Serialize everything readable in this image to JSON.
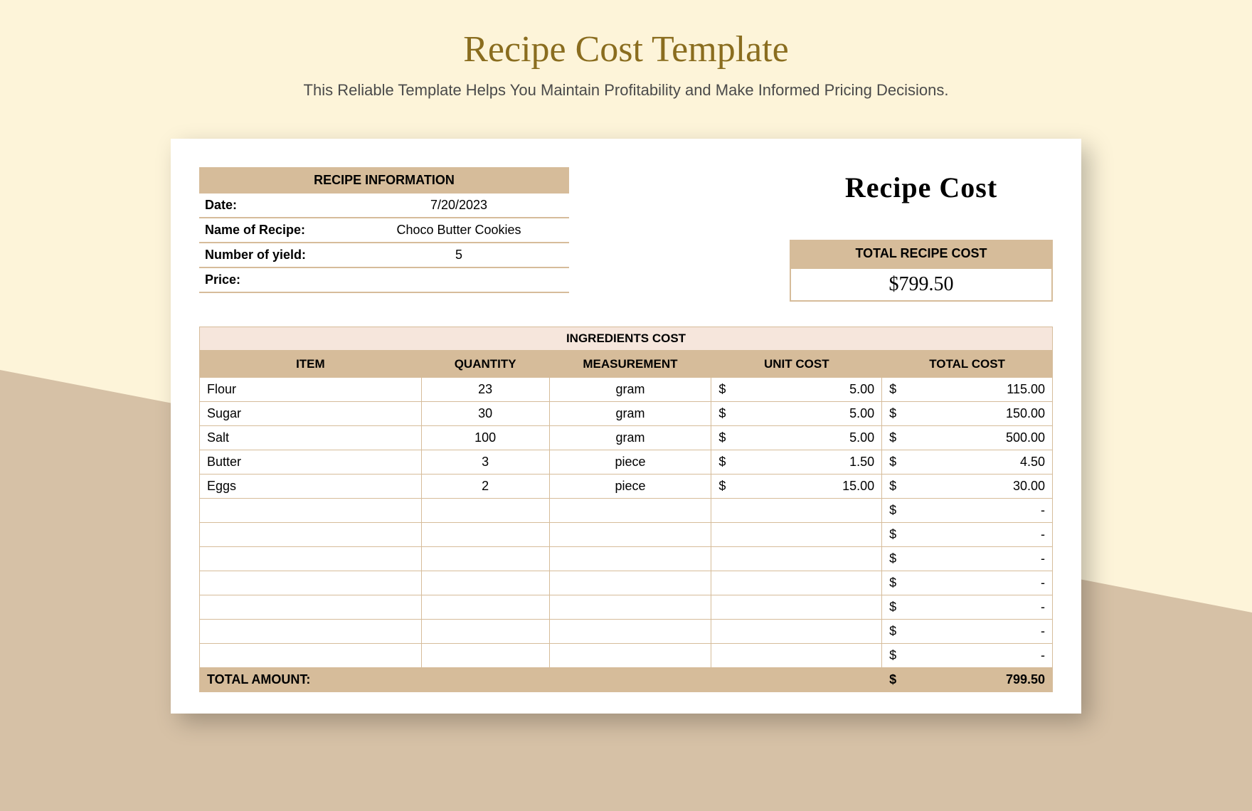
{
  "page": {
    "title": "Recipe Cost Template",
    "subtitle": "This Reliable Template Helps You Maintain Profitability and Make Informed Pricing Decisions."
  },
  "info": {
    "header": "RECIPE INFORMATION",
    "date_label": "Date:",
    "date_value": "7/20/2023",
    "name_label": "Name of Recipe:",
    "name_value": "Choco Butter Cookies",
    "yield_label": "Number of yield:",
    "yield_value": "5",
    "price_label": "Price:",
    "price_value": ""
  },
  "right": {
    "title": "Recipe Cost",
    "total_label": "TOTAL RECIPE COST",
    "total_value": "$799.50"
  },
  "ingredients": {
    "title": "INGREDIENTS COST",
    "headers": {
      "item": "ITEM",
      "qty": "QUANTITY",
      "meas": "MEASUREMENT",
      "unit": "UNIT COST",
      "total": "TOTAL COST"
    },
    "rows": [
      {
        "item": "Flour",
        "qty": "23",
        "meas": "gram",
        "unit": "5.00",
        "total": "115.00"
      },
      {
        "item": "Sugar",
        "qty": "30",
        "meas": "gram",
        "unit": "5.00",
        "total": "150.00"
      },
      {
        "item": "Salt",
        "qty": "100",
        "meas": "gram",
        "unit": "5.00",
        "total": "500.00"
      },
      {
        "item": "Butter",
        "qty": "3",
        "meas": "piece",
        "unit": "1.50",
        "total": "4.50"
      },
      {
        "item": "Eggs",
        "qty": "2",
        "meas": "piece",
        "unit": "15.00",
        "total": "30.00"
      },
      {
        "item": "",
        "qty": "",
        "meas": "",
        "unit": "",
        "total": "-"
      },
      {
        "item": "",
        "qty": "",
        "meas": "",
        "unit": "",
        "total": "-"
      },
      {
        "item": "",
        "qty": "",
        "meas": "",
        "unit": "",
        "total": "-"
      },
      {
        "item": "",
        "qty": "",
        "meas": "",
        "unit": "",
        "total": "-"
      },
      {
        "item": "",
        "qty": "",
        "meas": "",
        "unit": "",
        "total": "-"
      },
      {
        "item": "",
        "qty": "",
        "meas": "",
        "unit": "",
        "total": "-"
      },
      {
        "item": "",
        "qty": "",
        "meas": "",
        "unit": "",
        "total": "-"
      }
    ],
    "footer_label": "TOTAL AMOUNT:",
    "footer_value": "799.50",
    "currency": "$"
  }
}
